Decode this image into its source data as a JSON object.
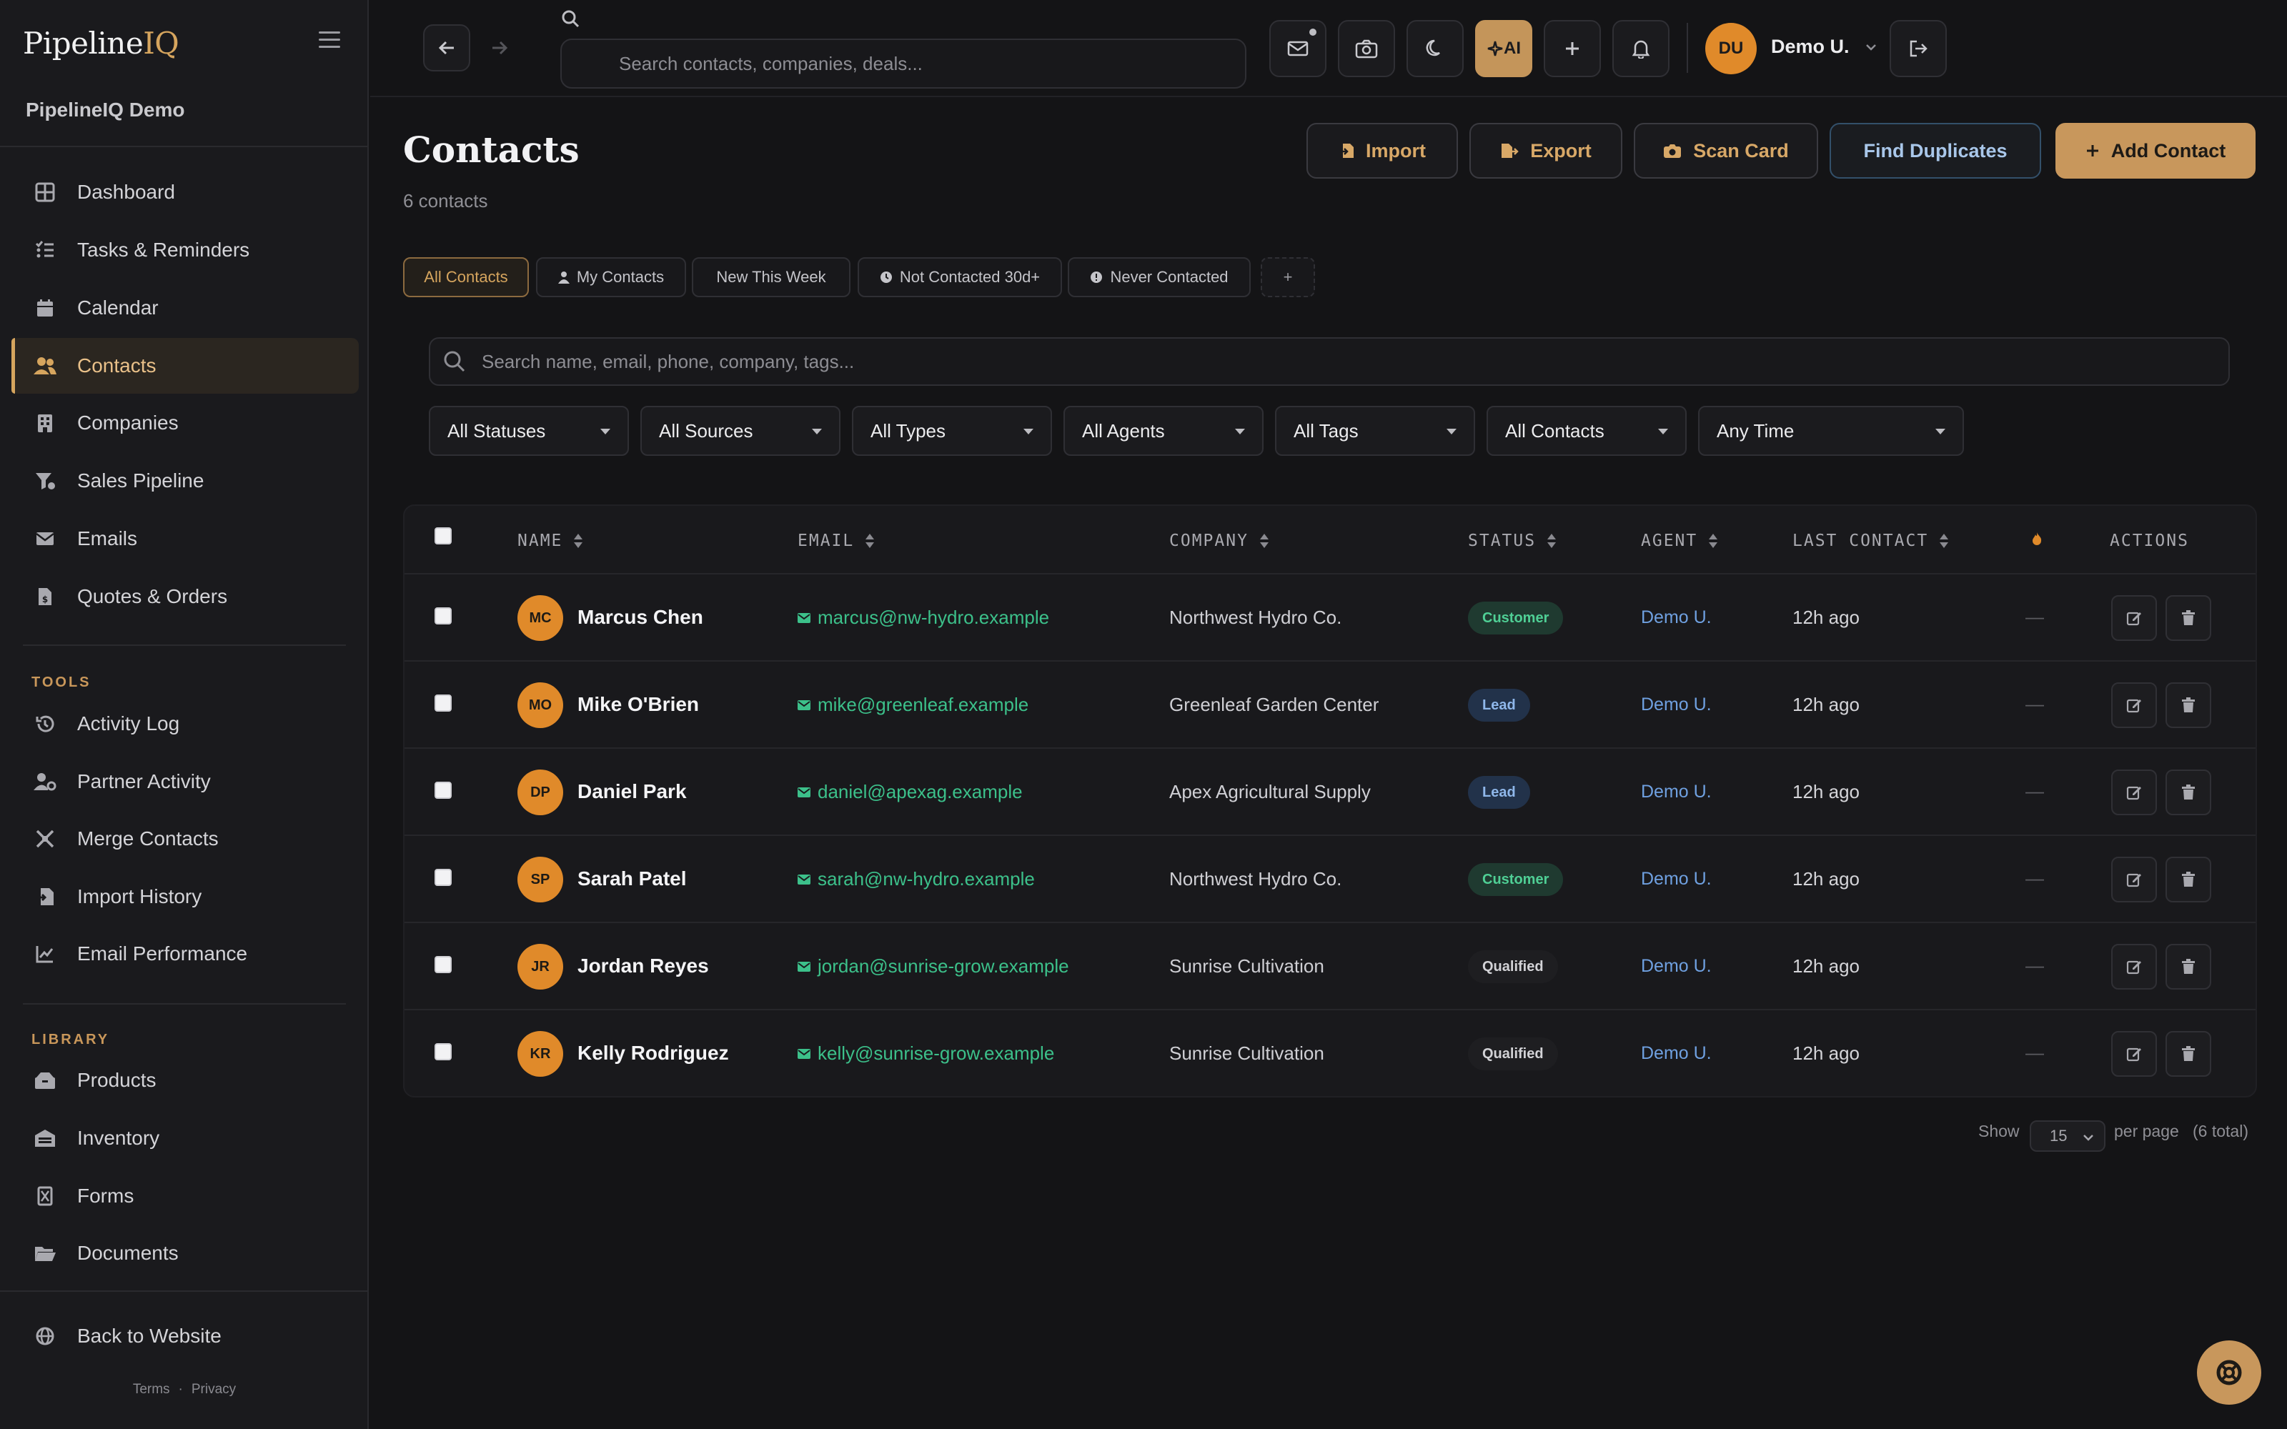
{
  "app": {
    "logo_main": "Pipeline",
    "logo_accent": "IQ",
    "org_name": "PipelineIQ Demo"
  },
  "sidebar": {
    "items": [
      {
        "label": "Dashboard",
        "icon": "dashboard-icon"
      },
      {
        "label": "Tasks & Reminders",
        "icon": "tasks-icon"
      },
      {
        "label": "Calendar",
        "icon": "calendar-icon"
      },
      {
        "label": "Contacts",
        "icon": "contacts-icon",
        "active": true
      },
      {
        "label": "Companies",
        "icon": "building-icon"
      },
      {
        "label": "Sales Pipeline",
        "icon": "funnel-icon"
      },
      {
        "label": "Emails",
        "icon": "envelope-icon"
      },
      {
        "label": "Quotes & Orders",
        "icon": "invoice-icon"
      }
    ],
    "tools_label": "TOOLS",
    "tools": [
      {
        "label": "Activity Log",
        "icon": "history-icon"
      },
      {
        "label": "Partner Activity",
        "icon": "user-cog-icon"
      },
      {
        "label": "Merge Contacts",
        "icon": "merge-icon"
      },
      {
        "label": "Import History",
        "icon": "file-import-icon"
      },
      {
        "label": "Email Performance",
        "icon": "chart-line-icon"
      }
    ],
    "library_label": "LIBRARY",
    "library": [
      {
        "label": "Products",
        "icon": "boxes-icon"
      },
      {
        "label": "Inventory",
        "icon": "warehouse-icon"
      },
      {
        "label": "Forms",
        "icon": "form-icon"
      },
      {
        "label": "Documents",
        "icon": "folder-open-icon"
      }
    ],
    "back_label": "Back to Website",
    "terms": "Terms",
    "separator": "·",
    "privacy": "Privacy"
  },
  "topbar": {
    "search_placeholder": "Search contacts, companies, deals...",
    "ai_label": "AI",
    "user_initials": "DU",
    "user_name": "Demo U."
  },
  "page": {
    "title": "Contacts",
    "subtitle": "6 contacts",
    "actions": {
      "import": "Import",
      "export": "Export",
      "scan": "Scan Card",
      "duplicates": "Find Duplicates",
      "add": "Add Contact"
    }
  },
  "views": {
    "all": "All Contacts",
    "mine": "My Contacts",
    "new_week": "New This Week",
    "not_contacted": "Not Contacted 30d+",
    "never": "Never Contacted",
    "add": "+"
  },
  "search": {
    "placeholder": "Search name, email, phone, company, tags..."
  },
  "filters": {
    "statuses": "All Statuses",
    "sources": "All Sources",
    "types": "All Types",
    "agents": "All Agents",
    "tags": "All Tags",
    "contacts": "All Contacts",
    "time": "Any Time"
  },
  "table": {
    "columns": {
      "name": "NAME",
      "email": "EMAIL",
      "company": "COMPANY",
      "status": "STATUS",
      "agent": "AGENT",
      "last_contact": "LAST CONTACT",
      "actions": "ACTIONS"
    },
    "rows": [
      {
        "initials": "MC",
        "name": "Marcus Chen",
        "email": "marcus@nw-hydro.example",
        "company": "Northwest Hydro Co.",
        "status": "Customer",
        "agent": "Demo U.",
        "last": "12h ago",
        "score": "—"
      },
      {
        "initials": "MO",
        "name": "Mike O'Brien",
        "email": "mike@greenleaf.example",
        "company": "Greenleaf Garden Center",
        "status": "Lead",
        "agent": "Demo U.",
        "last": "12h ago",
        "score": "—"
      },
      {
        "initials": "DP",
        "name": "Daniel Park",
        "email": "daniel@apexag.example",
        "company": "Apex Agricultural Supply",
        "status": "Lead",
        "agent": "Demo U.",
        "last": "12h ago",
        "score": "—"
      },
      {
        "initials": "SP",
        "name": "Sarah Patel",
        "email": "sarah@nw-hydro.example",
        "company": "Northwest Hydro Co.",
        "status": "Customer",
        "agent": "Demo U.",
        "last": "12h ago",
        "score": "—"
      },
      {
        "initials": "JR",
        "name": "Jordan Reyes",
        "email": "jordan@sunrise-grow.example",
        "company": "Sunrise Cultivation",
        "status": "Qualified",
        "agent": "Demo U.",
        "last": "12h ago",
        "score": "—"
      },
      {
        "initials": "KR",
        "name": "Kelly Rodriguez",
        "email": "kelly@sunrise-grow.example",
        "company": "Sunrise Cultivation",
        "status": "Qualified",
        "agent": "Demo U.",
        "last": "12h ago",
        "score": "—"
      }
    ]
  },
  "pagination": {
    "show": "Show",
    "per_page_value": "15",
    "per_page": "per page",
    "total": "(6 total)"
  },
  "colors": {
    "accent": "#c8975c",
    "bg": "#141416",
    "sidebar": "#1a1a1d",
    "customer": "#4fcf95",
    "lead": "#8fb7ea",
    "email": "#3cc08a",
    "agent": "#6fa0e0"
  }
}
